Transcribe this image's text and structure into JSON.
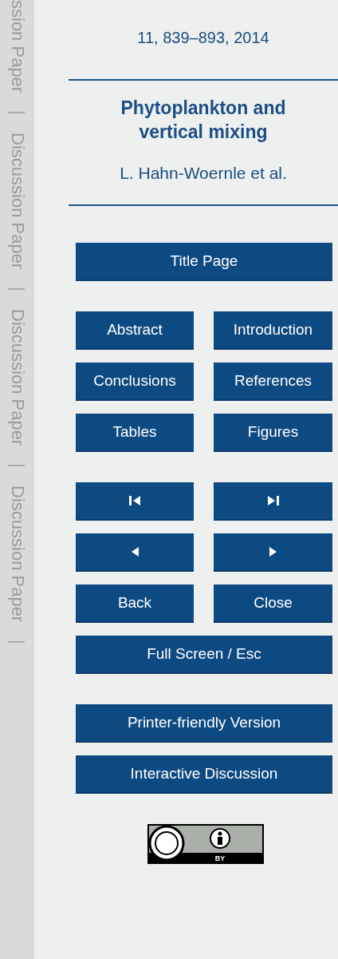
{
  "margin_labels": [
    {
      "text": "ssion Paper",
      "kind": "label"
    },
    {
      "text": "|",
      "kind": "bar"
    },
    {
      "text": "Discussion Paper",
      "kind": "label"
    },
    {
      "text": "|",
      "kind": "bar"
    },
    {
      "text": "Discussion Paper",
      "kind": "label"
    },
    {
      "text": "|",
      "kind": "bar"
    },
    {
      "text": "Discussion Paper",
      "kind": "label"
    },
    {
      "text": "|",
      "kind": "bar"
    }
  ],
  "citation": "11, 839–893, 2014",
  "title": "Phytoplankton and vertical mixing",
  "authors": "L. Hahn-Woernle et al.",
  "button_groups": [
    {
      "buttons": [
        {
          "kind": "wide",
          "label": "Title Page"
        }
      ]
    },
    {
      "buttons": [
        {
          "kind": "half",
          "label": "Abstract"
        },
        {
          "kind": "half",
          "label": "Introduction"
        },
        {
          "kind": "half",
          "label": "Conclusions"
        },
        {
          "kind": "half",
          "label": "References"
        },
        {
          "kind": "half",
          "label": "Tables"
        },
        {
          "kind": "half",
          "label": "Figures"
        }
      ]
    },
    {
      "buttons": [
        {
          "kind": "icon"
        },
        {
          "kind": "icon"
        },
        {
          "kind": "icon"
        },
        {
          "kind": "icon"
        },
        {
          "kind": "half",
          "label": "Back"
        },
        {
          "kind": "half",
          "label": "Close"
        },
        {
          "kind": "wide",
          "label": "Full Screen / Esc"
        }
      ]
    },
    {
      "buttons": [
        {
          "kind": "wide",
          "label": "Printer-friendly Version"
        },
        {
          "kind": "wide",
          "label": "Interactive Discussion"
        }
      ]
    }
  ],
  "license_badge": {
    "caption": "BY"
  }
}
